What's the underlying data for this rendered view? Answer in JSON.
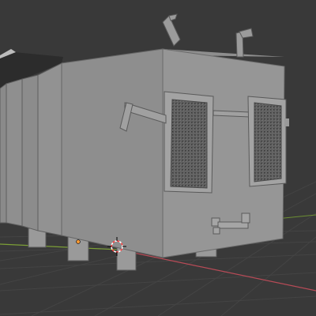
{
  "viewport": {
    "background_color": "#393939",
    "grid_color": "#444444",
    "x_axis_color": "#b84b57",
    "y_axis_color": "#7c9f37",
    "origin_color": "#ff9a33",
    "cursor_colors": [
      "#ff4444",
      "#ffffff"
    ]
  },
  "model": {
    "base_color": "#8e8e8e",
    "face_color": "#999999",
    "side_color": "#8a8a8a",
    "dark_color": "#2b2b2b",
    "goggle_glass_color": "#5e5e5e",
    "icons": [
      "object-origin-icon",
      "3d-cursor-icon"
    ]
  }
}
